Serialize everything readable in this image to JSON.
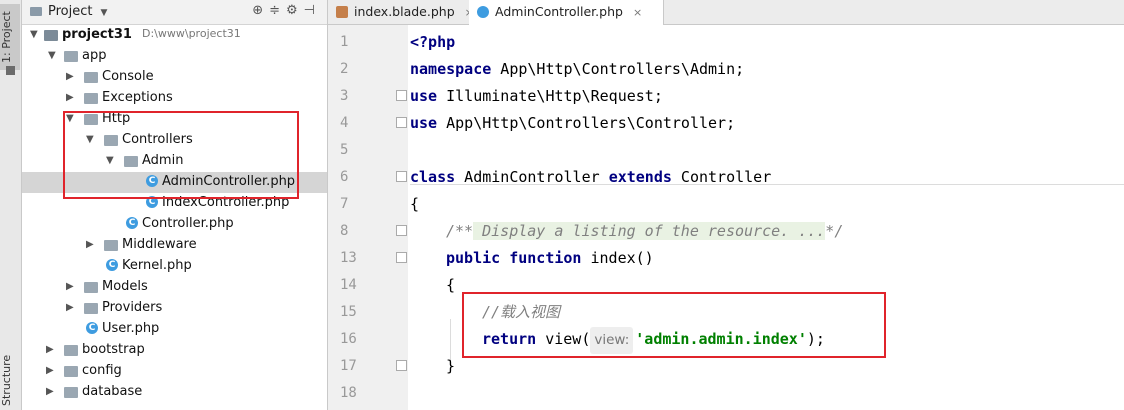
{
  "side_strip": {
    "project_tab": "1: Project",
    "structure_tab": "Structure"
  },
  "project_panel": {
    "title": "Project",
    "dropdown_caret": "▼",
    "toolbar_icons": [
      "⊕",
      "≑",
      "⚙",
      "⊣"
    ]
  },
  "tree": [
    {
      "label": "project31",
      "path": "D:\\www\\project31",
      "kind": "project",
      "arrow": "▼"
    },
    {
      "label": "app",
      "kind": "folder",
      "arrow": "▼"
    },
    {
      "label": "Console",
      "kind": "folder",
      "arrow": "▶"
    },
    {
      "label": "Exceptions",
      "kind": "folder",
      "arrow": "▶"
    },
    {
      "label": "Http",
      "kind": "folder",
      "arrow": "▼"
    },
    {
      "label": "Controllers",
      "kind": "folder",
      "arrow": "▼"
    },
    {
      "label": "Admin",
      "kind": "folder",
      "arrow": "▼"
    },
    {
      "label": "AdminController.php",
      "kind": "class",
      "arrow": ""
    },
    {
      "label": "IndexController.php",
      "kind": "class",
      "arrow": ""
    },
    {
      "label": "Controller.php",
      "kind": "class",
      "arrow": ""
    },
    {
      "label": "Middleware",
      "kind": "folder",
      "arrow": "▶"
    },
    {
      "label": "Kernel.php",
      "kind": "class",
      "arrow": ""
    },
    {
      "label": "Models",
      "kind": "folder",
      "arrow": "▶"
    },
    {
      "label": "Providers",
      "kind": "folder",
      "arrow": "▶"
    },
    {
      "label": "User.php",
      "kind": "class",
      "arrow": ""
    },
    {
      "label": "bootstrap",
      "kind": "folder",
      "arrow": "▶"
    },
    {
      "label": "config",
      "kind": "folder",
      "arrow": "▶"
    },
    {
      "label": "database",
      "kind": "folder",
      "arrow": "▶"
    }
  ],
  "tabs": [
    {
      "label": "index.blade.php",
      "close": "×"
    },
    {
      "label": "AdminController.php",
      "close": "×"
    }
  ],
  "class_icon_letter": "C",
  "editor": {
    "line_numbers": [
      "1",
      "2",
      "3",
      "4",
      "5",
      "6",
      "7",
      "8",
      "13",
      "14",
      "15",
      "16",
      "17",
      "18"
    ],
    "lines": {
      "l1_open": "<?php",
      "l2_kw": "namespace",
      "l2_rest": " App\\Http\\Controllers\\Admin;",
      "l3_kw": "use",
      "l3_rest": " Illuminate\\Http\\Request;",
      "l4_kw": "use",
      "l4_rest": " App\\Http\\Controllers\\Controller;",
      "l6_kw1": "class",
      "l6_name": " AdminController ",
      "l6_kw2": "extends",
      "l6_rest": " Controller",
      "l7": "{",
      "l8_comment_open": "/**",
      "l8_comment_body": " Display a listing of the resource. ...",
      "l8_comment_close": "*/",
      "l13_kw1": "public",
      "l13_kw2": " function",
      "l13_rest": " index()",
      "l14": "{",
      "l15_comment": "//载入视图",
      "l16_kw": "return",
      "l16_call": " view(",
      "l16_hint": "view:",
      "l16_str": "'admin.admin.index'",
      "l16_end": ");",
      "l17": "}"
    }
  }
}
